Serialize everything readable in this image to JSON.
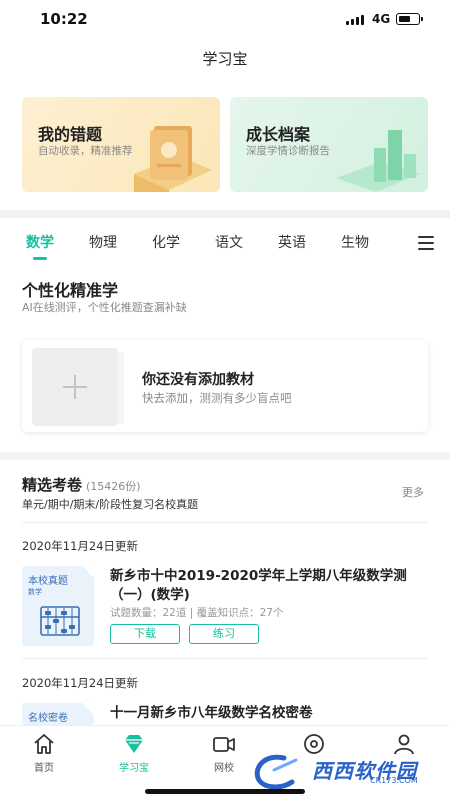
{
  "status_bar": {
    "time": "10:22",
    "network": "4G"
  },
  "page": {
    "title": "学习宝"
  },
  "promos": [
    {
      "title": "我的错题",
      "desc": "自动收录，精准推荐",
      "color": "#fbe6b8"
    },
    {
      "title": "成长档案",
      "desc": "深度学情诊断报告",
      "color": "#d3f0df"
    }
  ],
  "subjects": {
    "tabs": [
      "数学",
      "物理",
      "化学",
      "语文",
      "英语",
      "生物"
    ],
    "active": "数学",
    "menu_icon": "menu-icon"
  },
  "personalized": {
    "title": "个性化精准学",
    "subtitle": "AI在线测评，个性化推题查漏补缺"
  },
  "textbook": {
    "title": "你还没有添加教材",
    "subtitle": "快去添加，测测有多少盲点吧"
  },
  "exams": {
    "title": "精选考卷",
    "count": "(15426份)",
    "subtitle": "单元/期中/期末/阶段性复习名校真题",
    "more": "更多",
    "items": [
      {
        "date": "2020年11月24日更新",
        "thumb_label": "本校真题",
        "thumb_sub": "数学",
        "title": "新乡市十中2019-2020学年上学期八年级数学测（一）(数学)",
        "meta": "试题数量：22道 | 覆盖知识点：27个",
        "download_label": "下载",
        "practice_label": "练习"
      },
      {
        "date": "2020年11月24日更新",
        "thumb_label": "名校密卷",
        "title": "十一月新乡市八年级数学名校密卷"
      }
    ]
  },
  "tab_bar": {
    "items": [
      {
        "label": "首页",
        "icon": "home-icon"
      },
      {
        "label": "学习宝",
        "icon": "diamond-icon"
      },
      {
        "label": "网校",
        "icon": "video-icon"
      },
      {
        "label": "",
        "icon": "compass-icon"
      },
      {
        "label": "",
        "icon": "user-icon"
      }
    ],
    "active": "学习宝"
  },
  "watermark": {
    "text": "西西软件园",
    "url": "CR173.COM"
  },
  "colors": {
    "accent": "#16c0a0",
    "thumb_blue": "#3b6fb8"
  }
}
